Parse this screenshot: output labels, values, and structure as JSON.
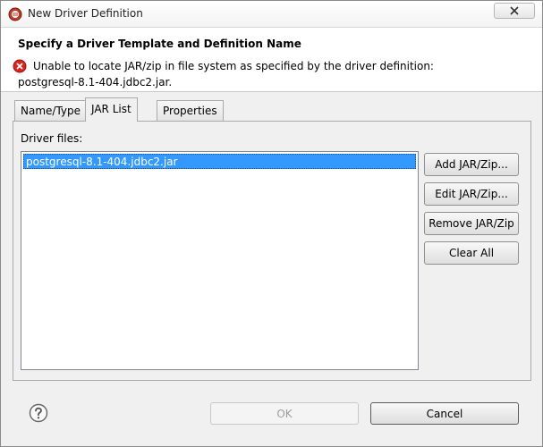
{
  "window": {
    "title": "New Driver Definition"
  },
  "header": {
    "title": "Specify a Driver Template and Definition Name",
    "error_line1": "Unable to locate JAR/zip in file system as specified by the driver definition:",
    "error_line2": "postgresql-8.1-404.jdbc2.jar."
  },
  "tabs": [
    {
      "label": "Name/Type",
      "active": false
    },
    {
      "label": "JAR List",
      "active": true
    },
    {
      "label": "Properties",
      "active": false
    }
  ],
  "jar_list": {
    "label": "Driver files:",
    "files": [
      "postgresql-8.1-404.jdbc2.jar"
    ],
    "buttons": {
      "add": "Add JAR/Zip...",
      "edit": "Edit JAR/Zip...",
      "remove": "Remove JAR/Zip",
      "clear": "Clear All"
    }
  },
  "footer": {
    "ok": "OK",
    "cancel": "Cancel"
  },
  "colors": {
    "selection": "#3399ff",
    "error_icon": "#d9241c"
  }
}
